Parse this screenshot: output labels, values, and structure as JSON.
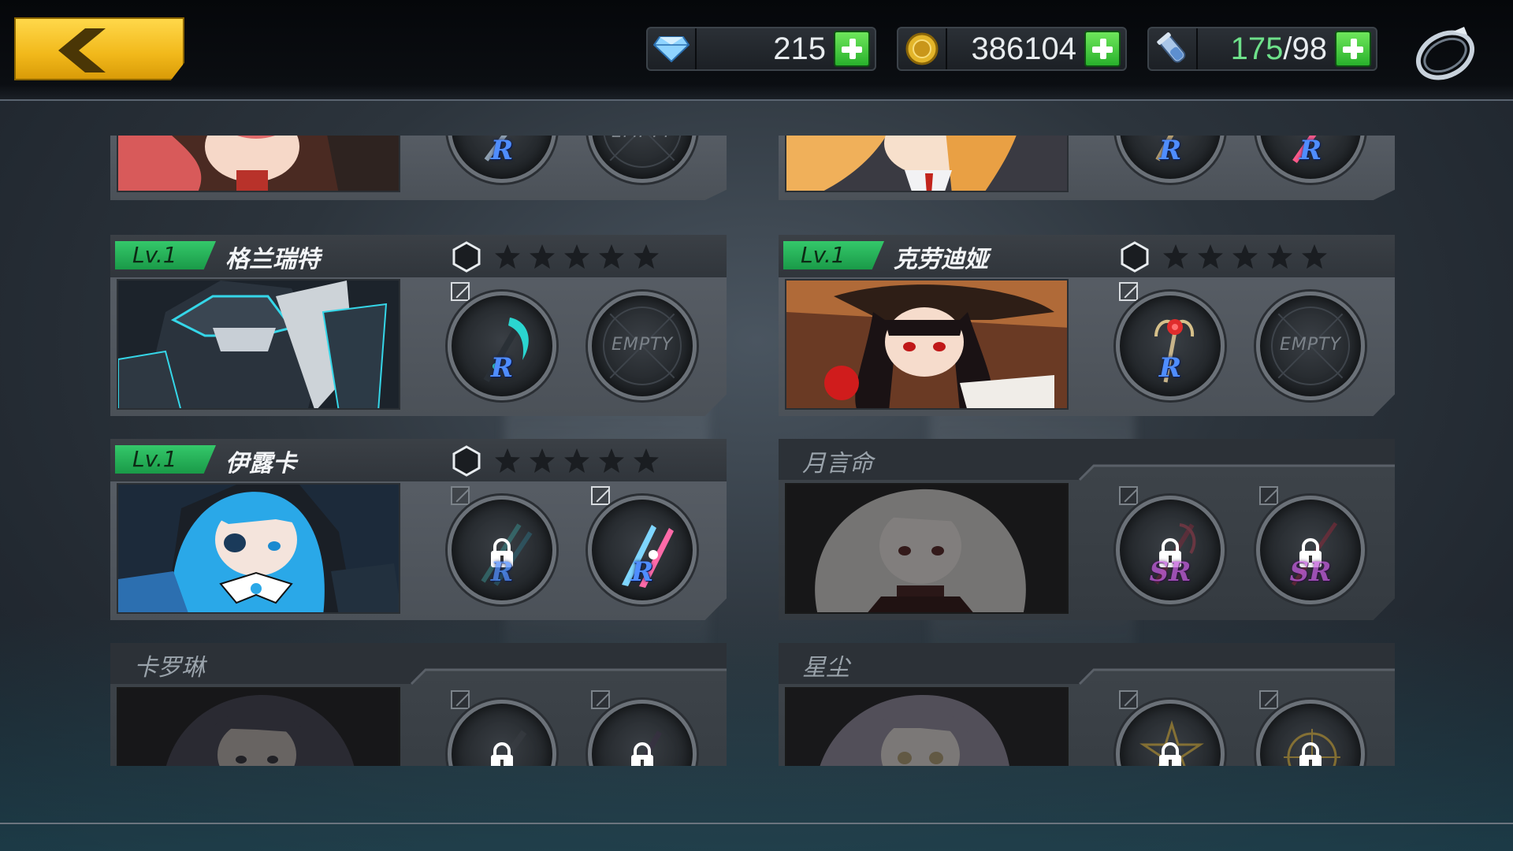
{
  "header": {
    "back_button": "back",
    "resources": [
      {
        "id": "diamond",
        "icon": "diamond-icon",
        "value": "215"
      },
      {
        "id": "gold",
        "icon": "gold-coin-icon",
        "value": "386104"
      },
      {
        "id": "stamina",
        "icon": "stamina-potion-icon",
        "value_current": "175",
        "value_rest": "/98"
      }
    ],
    "settings_icon": "settings-ring-icon"
  },
  "empty_label": "EMPTY",
  "characters": [
    {
      "id": "top-left-partial",
      "level": "",
      "name": "",
      "unlocked": true,
      "slots": [
        {
          "type": "weapon",
          "rarity": "R"
        },
        {
          "type": "empty"
        }
      ]
    },
    {
      "id": "top-right-partial",
      "level": "",
      "name": "",
      "unlocked": true,
      "slots": [
        {
          "type": "weapon",
          "rarity": "R"
        },
        {
          "type": "weapon",
          "rarity": "R"
        }
      ]
    },
    {
      "id": "gelante",
      "level": "Lv.1",
      "name": "格兰瑞特",
      "unlocked": true,
      "stars": 0,
      "slots": [
        {
          "type": "weapon",
          "rarity": "R"
        },
        {
          "type": "empty"
        }
      ]
    },
    {
      "id": "claudia",
      "level": "Lv.1",
      "name": "克劳迪娅",
      "unlocked": true,
      "stars": 0,
      "slots": [
        {
          "type": "weapon",
          "rarity": "R"
        },
        {
          "type": "empty"
        }
      ]
    },
    {
      "id": "yiluka",
      "level": "Lv.1",
      "name": "伊露卡",
      "unlocked": true,
      "stars": 0,
      "slots": [
        {
          "type": "locked-weapon",
          "rarity": "R"
        },
        {
          "type": "weapon",
          "rarity": "R"
        }
      ]
    },
    {
      "id": "yueyanming",
      "level": "",
      "name": "月言命",
      "unlocked": false,
      "slots": [
        {
          "type": "locked-weapon",
          "rarity": "SR"
        },
        {
          "type": "locked-weapon",
          "rarity": "SR"
        }
      ]
    },
    {
      "id": "kaluolin",
      "level": "",
      "name": "卡罗琳",
      "unlocked": false,
      "slots": [
        {
          "type": "locked-weapon"
        },
        {
          "type": "locked-weapon"
        }
      ]
    },
    {
      "id": "xingchen",
      "level": "",
      "name": "星尘",
      "unlocked": false,
      "slots": [
        {
          "type": "locked-weapon"
        },
        {
          "type": "locked-weapon"
        }
      ]
    }
  ],
  "colors": {
    "accent_gold": "#f1b81a",
    "level_green": "#1fb24f",
    "rarity_r": "#4f8dff",
    "rarity_sr": "#c25bdc",
    "plus_green": "#29b12c"
  }
}
